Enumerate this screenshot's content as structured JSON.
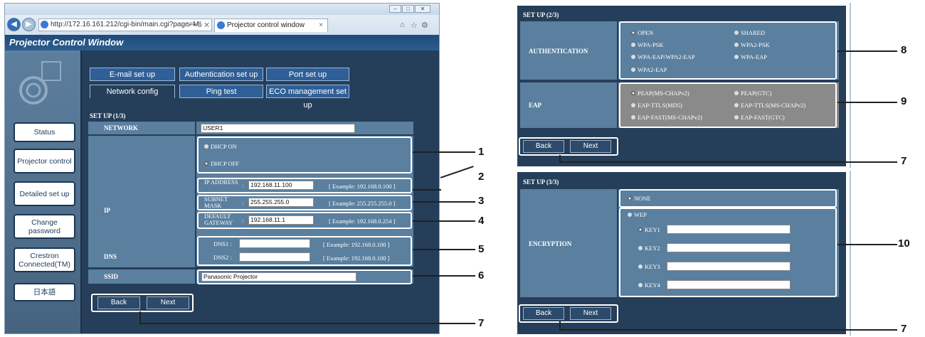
{
  "browser": {
    "url": "http://172.16.161.212/cgi-bin/main.cgi?page=MI",
    "address_actions": "⌕ • ↻ ✕",
    "tab_title": "Projector control window",
    "tab_close": "×"
  },
  "app": {
    "title": "Projector Control Window"
  },
  "sidebar": {
    "status": "Status",
    "projector_control": "Projector control",
    "detailed_set_up": "Detailed set up",
    "change_password": "Change password",
    "crestron": "Crestron Connected(TM)",
    "japanese": "日本語"
  },
  "tabs": {
    "email": "E-mail set up",
    "authentication": "Authentication set up",
    "port": "Port set up",
    "network": "Network config",
    "ping": "Ping test",
    "eco": "ECO management set up"
  },
  "setup1": {
    "title": "SET UP (1/3)",
    "network_label": "NETWORK",
    "network_value": "USER1",
    "ip_label": "IP",
    "dhcp_on": "DHCP ON",
    "dhcp_off": "DHCP OFF",
    "ip_address_label": "IP ADDRESS",
    "ip_address_value": "192.168.11.100",
    "ip_address_example": "[ Example: 192.168.0.100 ]",
    "subnet_label": "SUBNET MASK",
    "subnet_value": "255.255.255.0",
    "subnet_example": "[ Example: 255.255.255.0 ]",
    "gateway_label": "DEFAULT GATEWAY",
    "gateway_value": "192.168.11.1",
    "gateway_example": "[ Example: 192.168.0.254 ]",
    "dns_label": "DNS",
    "dns1_label": "DNS1 :",
    "dns1_value": "",
    "dns1_example": "[ Example: 192.168.0.100 ]",
    "dns2_label": "DNS2 :",
    "dns2_value": "",
    "dns2_example": "[ Example: 192.168.0.100 ]",
    "ssid_label": "SSID",
    "ssid_value": "Panasonic Projector",
    "back": "Back",
    "next": "Next"
  },
  "setup2": {
    "title": "SET UP (2/3)",
    "auth_label": "AUTHENTICATION",
    "auth_options": [
      "OPEN",
      "SHARED",
      "WPA-PSK",
      "WPA2-PSK",
      "WPA-EAP/WPA2-EAP",
      "WPA-EAP",
      "WPA2-EAP"
    ],
    "eap_label": "EAP",
    "eap_options": [
      "PEAP(MS-CHAPv2)",
      "PEAP(GTC)",
      "EAP-TTLS(MD5)",
      "EAP-TTLS(MS-CHAPv2)",
      "EAP-FAST(MS-CHAPv2)",
      "EAP-FAST(GTC)"
    ],
    "back": "Back",
    "next": "Next"
  },
  "setup3": {
    "title": "SET UP (3/3)",
    "encryption_label": "ENCRYPTION",
    "none": "NONE",
    "wep": "WEP",
    "keys": [
      "KEY1",
      "KEY2",
      "KEY3",
      "KEY4"
    ],
    "back": "Back",
    "next": "Next"
  },
  "callouts": [
    "1",
    "2",
    "3",
    "4",
    "5",
    "6",
    "7",
    "7",
    "8",
    "9",
    "10",
    "7"
  ]
}
